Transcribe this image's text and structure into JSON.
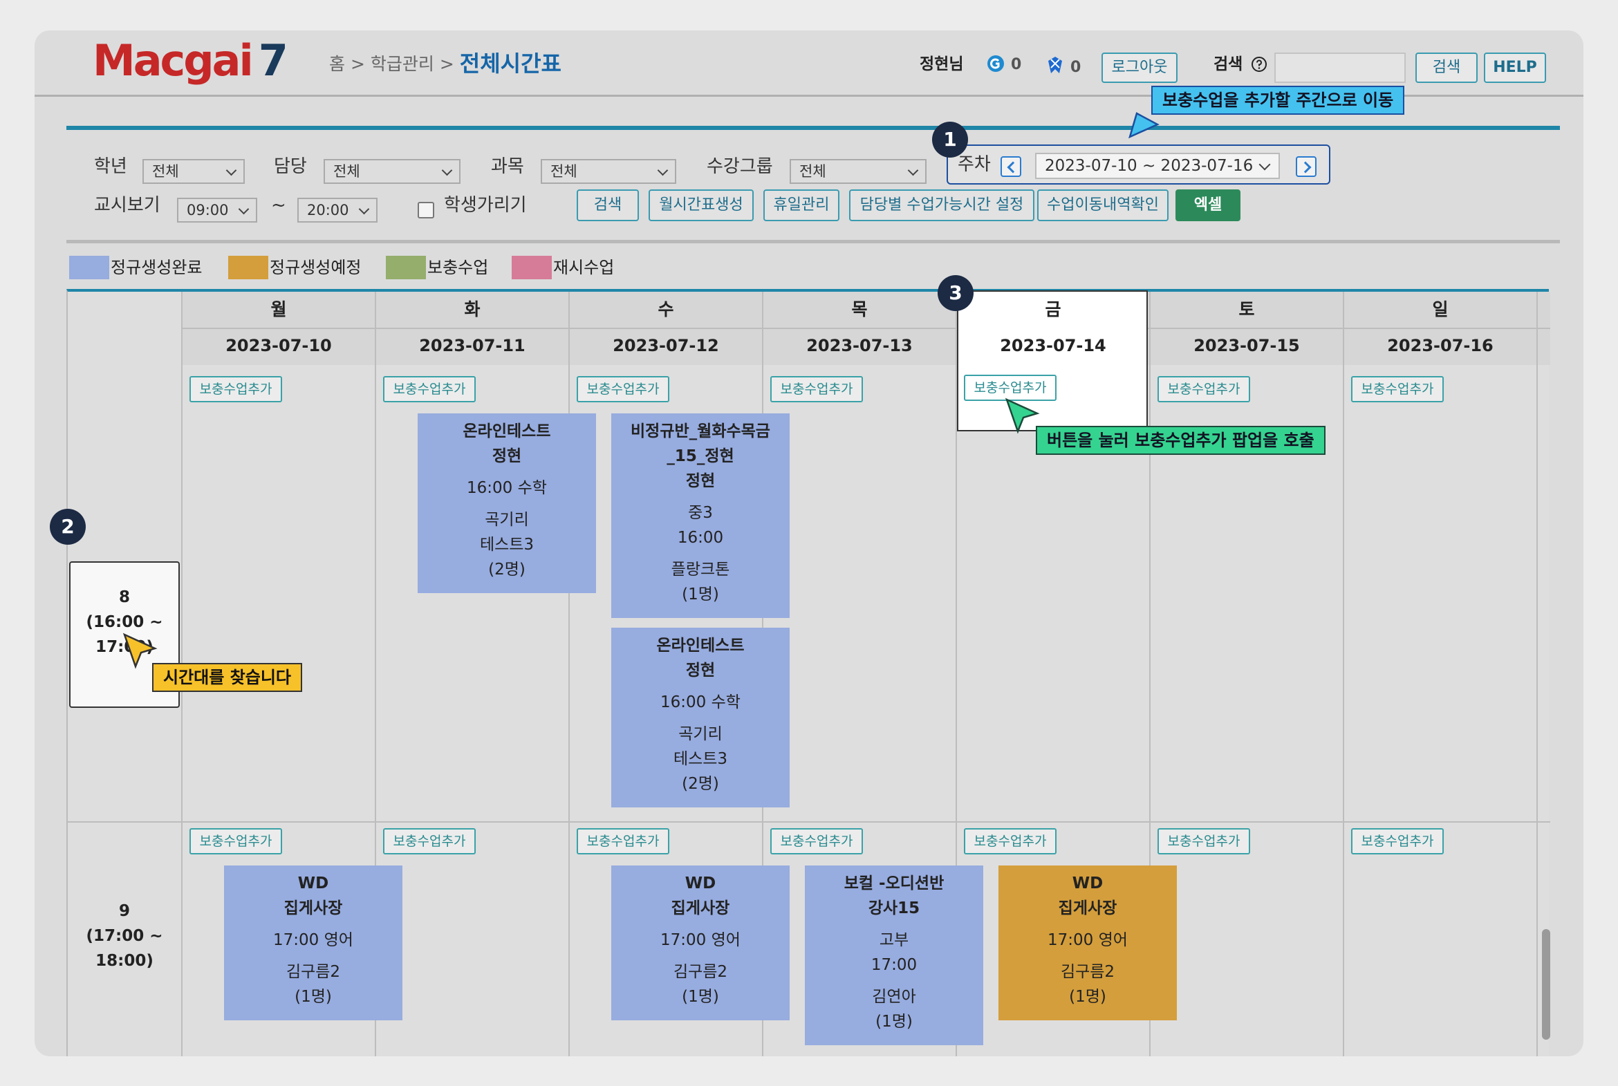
{
  "header": {
    "logo_main": "Macgai",
    "logo_num": "7",
    "breadcrumb_home": "홈",
    "breadcrumb_sep": ">",
    "breadcrumb_mid": "학급관리",
    "breadcrumb_current": "전체시간표",
    "user": "정현님",
    "count_a": "0",
    "count_b": "0",
    "logout": "로그아웃",
    "search_label": "검색",
    "search_button": "검색",
    "help": "HELP"
  },
  "filters": {
    "grade_label": "학년",
    "grade_value": "전체",
    "teacher_label": "담당",
    "teacher_value": "전체",
    "subject_label": "과목",
    "subject_value": "전체",
    "group_label": "수강그룹",
    "group_value": "전체",
    "period_label": "교시보기",
    "period_from": "09:00",
    "period_tilde": "~",
    "period_to": "20:00",
    "hide_students": "학생가리기",
    "week_label": "주차",
    "week_value": "2023-07-10 ~ 2023-07-16",
    "buttons": [
      "검색",
      "월시간표생성",
      "휴일관리",
      "담당별 수업가능시간 설정",
      "수업이동내역확인",
      "엑셀"
    ]
  },
  "legend": [
    {
      "label": "정규생성완료",
      "color": "#97acdf"
    },
    {
      "label": "정규생성예정",
      "color": "#d49e3c"
    },
    {
      "label": "보충수업",
      "color": "#95ae6c"
    },
    {
      "label": "재시수업",
      "color": "#d67c98"
    }
  ],
  "days": [
    {
      "name": "월",
      "date": "2023-07-10"
    },
    {
      "name": "화",
      "date": "2023-07-11"
    },
    {
      "name": "수",
      "date": "2023-07-12"
    },
    {
      "name": "목",
      "date": "2023-07-13"
    },
    {
      "name": "금",
      "date": "2023-07-14"
    },
    {
      "name": "토",
      "date": "2023-07-15"
    },
    {
      "name": "일",
      "date": "2023-07-16"
    }
  ],
  "add_label": "보충수업추가",
  "slots": [
    {
      "num": "8",
      "range": "(16:00 ~",
      "end": "17:00)"
    },
    {
      "num": "9",
      "range": "(17:00 ~",
      "end": "18:00)"
    }
  ],
  "classes": {
    "tue8": {
      "lines": [
        "온라인테스트",
        "정현",
        "16:00   수학",
        "곡기리",
        "테스트3",
        "(2명)"
      ]
    },
    "wed8a": {
      "lines": [
        "비정규반_월화수목금",
        "_15_정현",
        "정현",
        "중3",
        "16:00",
        "플랑크톤",
        "(1명)"
      ]
    },
    "wed8b": {
      "lines": [
        "온라인테스트",
        "정현",
        "16:00   수학",
        "곡기리",
        "테스트3",
        "(2명)"
      ]
    },
    "mon9": {
      "lines": [
        "WD",
        "집게사장",
        "17:00   영어",
        "김구름2",
        "(1명)"
      ]
    },
    "wed9": {
      "lines": [
        "WD",
        "집게사장",
        "17:00   영어",
        "김구름2",
        "(1명)"
      ]
    },
    "thu9": {
      "lines": [
        "보컬 -오디션반",
        "강사15",
        "고부",
        "17:00",
        "김연아",
        "(1명)"
      ]
    },
    "fri9": {
      "lines": [
        "WD",
        "집게사장",
        "17:00   영어",
        "김구름2",
        "(1명)"
      ]
    }
  },
  "annotations": {
    "badge1": "1",
    "badge2": "2",
    "badge3": "3",
    "tip_week": "보충수업을 추가할 주간으로 이동",
    "tip_button": "버튼을 눌러 보충수업추가 팝업을 호출",
    "tip_slot": "시간대를 찾습니다"
  }
}
